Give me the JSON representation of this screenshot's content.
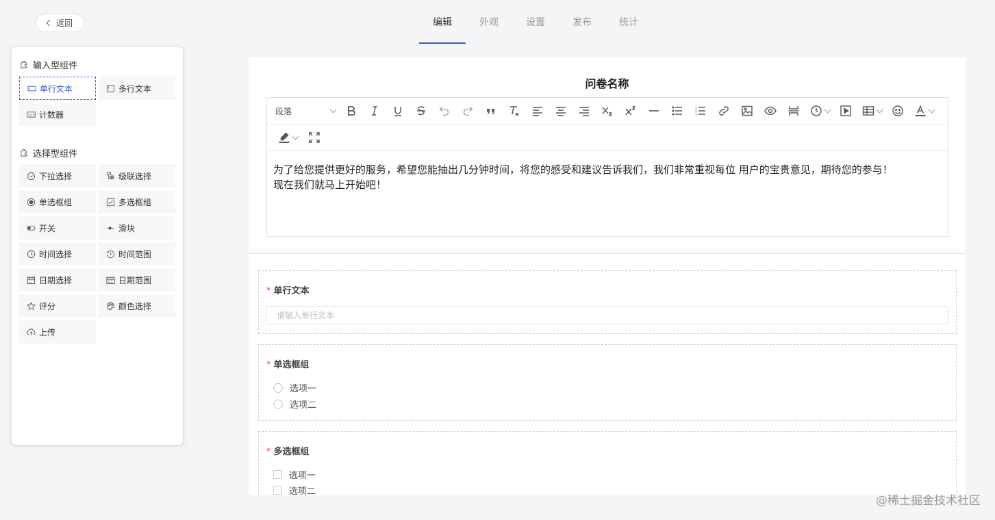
{
  "header": {
    "back_label": "返回",
    "tabs": [
      {
        "label": "编辑",
        "active": true
      },
      {
        "label": "外观",
        "active": false
      },
      {
        "label": "设置",
        "active": false
      },
      {
        "label": "发布",
        "active": false
      },
      {
        "label": "统计",
        "active": false
      }
    ]
  },
  "sidebar": {
    "input_group_title": "输入型组件",
    "input_items": [
      {
        "label": "单行文本",
        "icon": "single-line-text-icon",
        "selected": true
      },
      {
        "label": "多行文本",
        "icon": "multi-line-text-icon"
      },
      {
        "label": "计数器",
        "icon": "counter-icon"
      }
    ],
    "select_group_title": "选择型组件",
    "select_items": [
      {
        "label": "下拉选择",
        "icon": "dropdown-icon"
      },
      {
        "label": "级联选择",
        "icon": "cascader-icon"
      },
      {
        "label": "单选框组",
        "icon": "radio-icon"
      },
      {
        "label": "多选框组",
        "icon": "checkbox-icon"
      },
      {
        "label": "开关",
        "icon": "switch-icon"
      },
      {
        "label": "滑块",
        "icon": "slider-icon"
      },
      {
        "label": "时间选择",
        "icon": "clock-icon"
      },
      {
        "label": "时间范围",
        "icon": "time-range-icon"
      },
      {
        "label": "日期选择",
        "icon": "calendar-icon"
      },
      {
        "label": "日期范围",
        "icon": "date-range-icon"
      },
      {
        "label": "评分",
        "icon": "star-icon"
      },
      {
        "label": "颜色选择",
        "icon": "palette-icon"
      },
      {
        "label": "上传",
        "icon": "cloud-upload-icon"
      }
    ]
  },
  "form": {
    "title": "问卷名称",
    "editor": {
      "paragraph_select": "段落",
      "content_line1": "为了给您提供更好的服务，希望您能抽出几分钟时间，将您的感受和建议告诉我们，我们非常重视每位 用户的宝贵意见，期待您的参与！",
      "content_line2": "现在我们就马上开始吧！"
    },
    "fields": [
      {
        "type": "input",
        "label": "单行文本",
        "required": true,
        "placeholder": "请输入单行文本"
      },
      {
        "type": "radio",
        "label": "单选框组",
        "required": true,
        "options": [
          "选项一",
          "选项二"
        ]
      },
      {
        "type": "checkbox",
        "label": "多选框组",
        "required": true,
        "options": [
          "选项一",
          "选项二"
        ]
      }
    ]
  },
  "watermark": "@稀土掘金技术社区",
  "colors": {
    "accent": "#2b5fbb",
    "required": "#e05050",
    "selected_border": "#3d5fc4"
  }
}
